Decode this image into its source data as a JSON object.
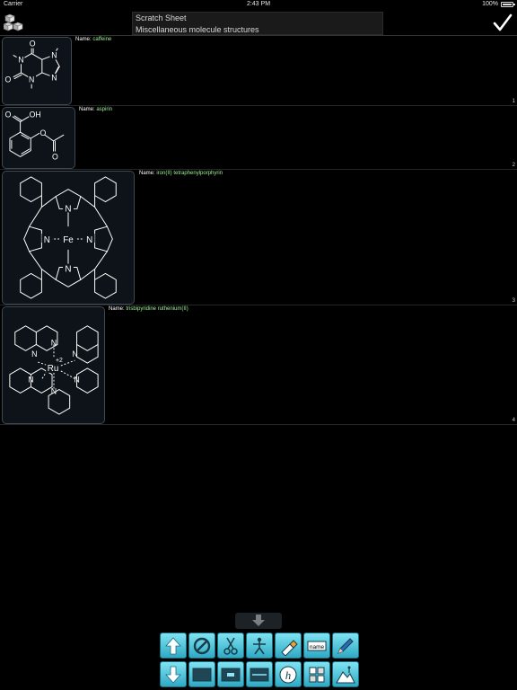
{
  "status": {
    "carrier": "Carrier",
    "time": "2:43 PM",
    "battery": "100%"
  },
  "header": {
    "title": "Scratch Sheet",
    "subtitle": "Miscellaneous molecule structures"
  },
  "molecules": [
    {
      "label": "Name:",
      "name": "caffeine",
      "index": "1"
    },
    {
      "label": "Name:",
      "name": "aspirin",
      "index": "2"
    },
    {
      "label": "Name:",
      "name": "iron(II) tetraphenylporphyrin",
      "index": "3"
    },
    {
      "label": "Name:",
      "name": "trisbipyridine ruthenium(II)",
      "index": "4"
    }
  ],
  "atoms": {
    "O": "O",
    "N": "N",
    "OH": "OH",
    "Fe": "Fe",
    "Ru": "Ru",
    "charge": "+2"
  },
  "toolbar": {
    "row1": [
      "arrow-up-icon",
      "no-entry-icon",
      "scissors-icon",
      "figure-icon",
      "glue-icon",
      "name-tag-icon",
      "pencil-icon"
    ],
    "row2": [
      "arrow-down-icon",
      "panel-icon",
      "panel-plus-icon",
      "panel-split-icon",
      "help-icon",
      "molecules-icon",
      "scene-icon"
    ],
    "name_tag": "name",
    "help": "h"
  },
  "colors": {
    "accent": "#4cc3dc",
    "name_value": "#9ef09a",
    "thumb_border": "#3c4a55"
  }
}
